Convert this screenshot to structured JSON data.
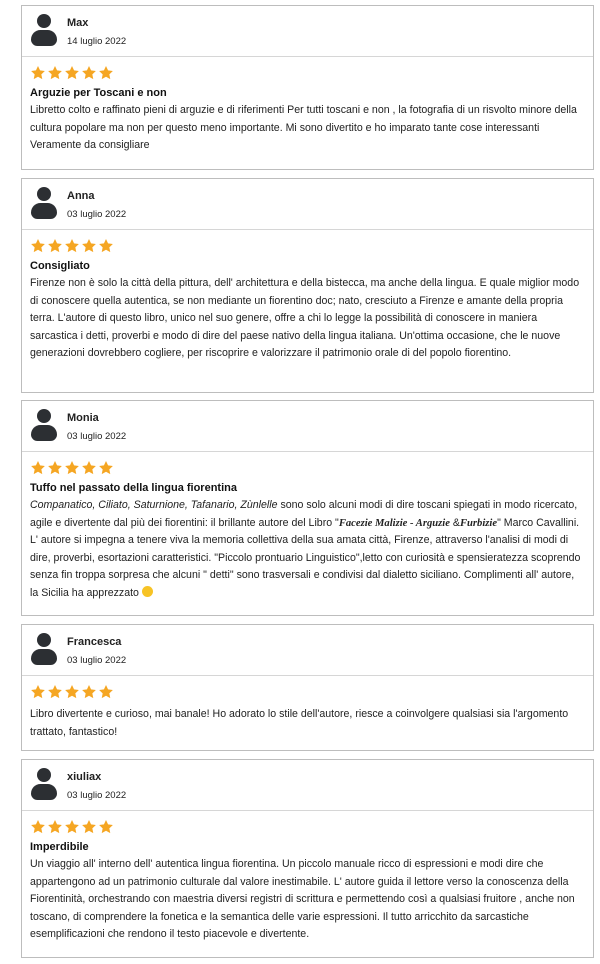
{
  "colors": {
    "star": "#f5a623",
    "border": "#bdbdbd",
    "text": "#222222"
  },
  "reviews": [
    {
      "name": "Max",
      "date": "14 luglio 2022",
      "rating": 5,
      "title": "Arguzie per Toscani e non",
      "text": "Libretto colto e raffinato pieni di arguzie e di riferimenti Per tutti toscani e non , la fotografia di un risvolto minore della cultura popolare ma non per questo meno importante. Mi sono divertito e ho imparato tante cose interessanti Veramente da consigliare"
    },
    {
      "name": "Anna",
      "date": "03 luglio 2022",
      "rating": 5,
      "title": "Consigliato",
      "text": "Firenze non è solo la città della pittura, dell' architettura e della bistecca, ma anche della lingua. E quale miglior modo di conoscere quella autentica, se non mediante un fiorentino doc; nato, cresciuto a Firenze e amante della propria terra. L'autore di questo libro, unico nel suo genere, offre a chi lo legge la possibilità di conoscere in maniera sarcastica i detti, proverbi e modo di dire del paese nativo della lingua italiana. Un'ottima occasione, che le nuove generazioni dovrebbero cogliere, per riscoprire e valorizzare il patrimonio orale di del popolo fiorentino."
    },
    {
      "name": "Monia",
      "date": "03 luglio 2022",
      "rating": 5,
      "title": "Tuffo nel passato della lingua fiorentina",
      "text_parts": {
        "italic1": "Companatico, Ciliato, Saturnione, Tafanario, Zùnlelle",
        "plain1": " sono solo alcuni modi di dire toscani spiegati in modo ricercato, agile e divertente dal più dei fiorentini: il brillante autore del Libro \"",
        "book1": "Facezie Malizie - Arguzie",
        "plain2": " &",
        "book2": "Furbizie",
        "plain3": "\" Marco Cavallini. L' autore si impegna a tenere viva la memoria collettiva della sua amata città, Firenze, attraverso l'analisi di modi di dire, proverbi, esortazioni caratteristici. \"Piccolo prontuario Linguistico\",letto con curiosità e spensieratezza scoprendo senza fin troppa sorpresa che alcuni \" detti\" sono trasversali e condivisi dal dialetto siciliano. Complimenti all' autore, la Sicilia ha apprezzato "
      }
    },
    {
      "name": "Francesca",
      "date": "03 luglio 2022",
      "rating": 5,
      "title": "",
      "text": "Libro divertente e curioso, mai banale! Ho adorato lo stile dell'autore, riesce a coinvolgere qualsiasi sia l'argomento trattato, fantastico!"
    },
    {
      "name": "xiuliax",
      "date": "03 luglio 2022",
      "rating": 5,
      "title": "Imperdibile",
      "text": "Un viaggio all' interno dell' autentica lingua fiorentina. Un piccolo manuale ricco di espressioni e modi dire che appartengono ad un patrimonio culturale dal valore inestimabile. L' autore guida il lettore verso la conoscenza della Fiorentinità, orchestrando con maestria diversi registri di scrittura e permettendo così a qualsiasi fruitore , anche non toscano, di comprendere la fonetica e la semantica delle varie espressioni. Il tutto arricchito da sarcastiche esemplificazioni che rendono il testo piacevole e divertente."
    }
  ]
}
